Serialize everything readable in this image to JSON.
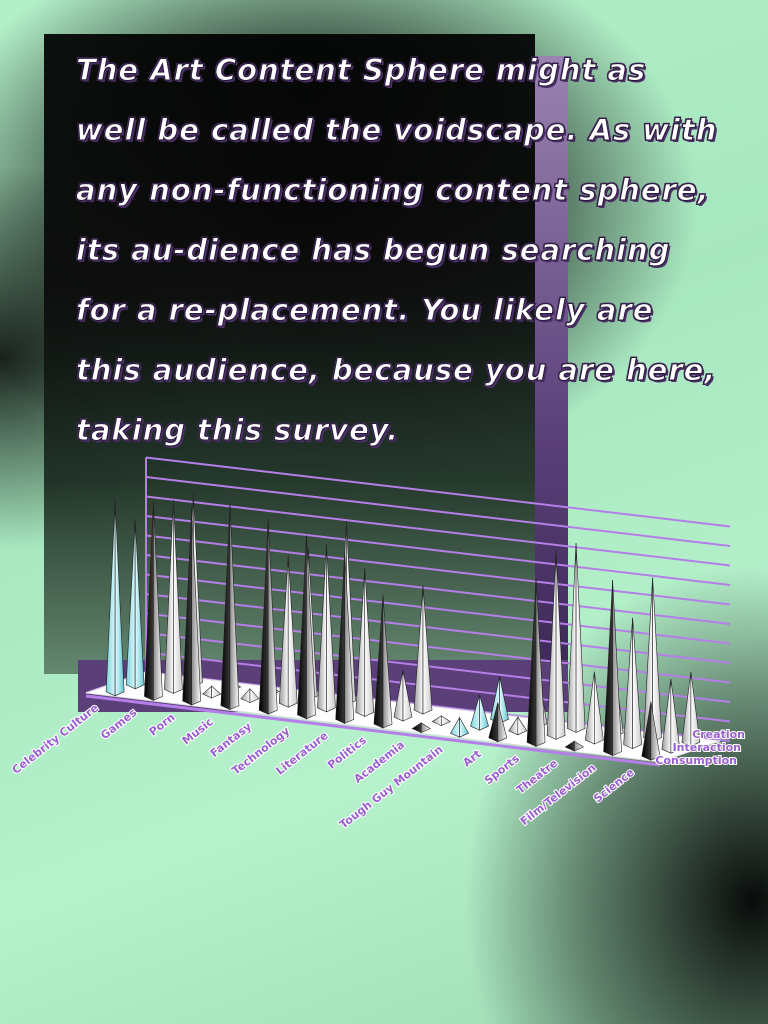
{
  "intro_text": "The Art Content Sphere might as well be called the voidscape. As with any non-functioning content sphere, its au-dience has begun searching for a re-placement. You likely are this audience, because you are here, taking this survey.",
  "chart_data": {
    "type": "3d-cone-bar",
    "categories": [
      "Celebrity Culture",
      "Games",
      "Porn",
      "Music",
      "Fantasy",
      "Technology",
      "Literature",
      "Politics",
      "Academia",
      "Tough Guy Mountain",
      "Art",
      "Sports",
      "Theatre",
      "Film/Television",
      "Science"
    ],
    "series": [
      {
        "name": "Consumption",
        "values": [
          9.8,
          10.0,
          9.9,
          10.4,
          9.8,
          9.2,
          8.6,
          6.6,
          0.3,
          0.8,
          1.8,
          8.4,
          0.3,
          8.8,
          2.8
        ]
      },
      {
        "name": "Interaction",
        "values": [
          8.5,
          9.7,
          0.4,
          0.5,
          7.6,
          8.4,
          7.4,
          2.4,
          0.3,
          1.6,
          0.7,
          9.5,
          3.5,
          6.5,
          3.6
        ]
      },
      {
        "name": "Creation",
        "values": [
          0.0,
          9.7,
          0.3,
          0.3,
          7.6,
          9.2,
          0.0,
          6.4,
          0.0,
          2.2,
          2.9,
          9.5,
          3.4,
          8.2,
          3.6
        ]
      }
    ],
    "series_colors": {
      "highlight": "#5ee8f0",
      "light": "#ffffff",
      "dark": "#000000"
    },
    "gridline_color": "#b57ee8",
    "ylim": [
      0,
      11
    ]
  }
}
